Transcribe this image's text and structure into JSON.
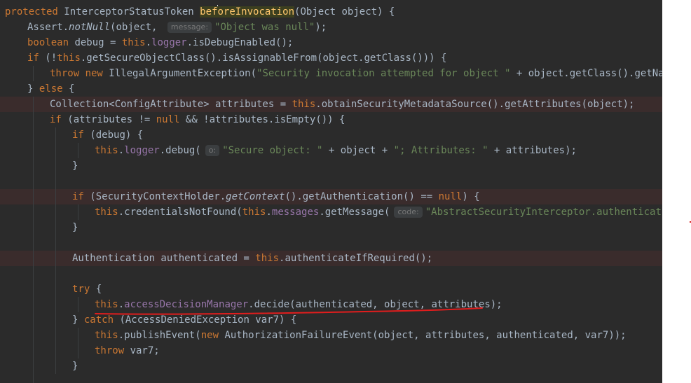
{
  "editor": {
    "line_height": 22,
    "char_width": 8.0,
    "indent_unit": 4,
    "lines": [
      {
        "indent": 0,
        "highlight": false,
        "tokens": [
          {
            "t": "protected ",
            "c": "kw"
          },
          {
            "t": "InterceptorStatusToken ",
            "c": ""
          },
          {
            "t": "bef",
            "c": "fn hl-word"
          },
          {
            "t": "caret",
            "c": "caret"
          },
          {
            "t": "oreInvocation",
            "c": "fn hl-word"
          },
          {
            "t": "(Object object) {",
            "c": ""
          }
        ]
      },
      {
        "indent": 1,
        "highlight": false,
        "tokens": [
          {
            "t": "Assert.",
            "c": ""
          },
          {
            "t": "notNull",
            "c": "it"
          },
          {
            "t": "(object, ",
            "c": ""
          },
          {
            "t": "message:",
            "c": "hint"
          },
          {
            "t": "\"Object was null\"",
            "c": "str"
          },
          {
            "t": ");",
            "c": ""
          }
        ]
      },
      {
        "indent": 1,
        "highlight": false,
        "tokens": [
          {
            "t": "boolean ",
            "c": "kw"
          },
          {
            "t": "debug = ",
            "c": ""
          },
          {
            "t": "this",
            "c": "kw"
          },
          {
            "t": ".",
            "c": ""
          },
          {
            "t": "logger",
            "c": "fld"
          },
          {
            "t": ".isDebugEnabled();",
            "c": ""
          }
        ]
      },
      {
        "indent": 1,
        "highlight": false,
        "tokens": [
          {
            "t": "if ",
            "c": "kw"
          },
          {
            "t": "(!",
            "c": ""
          },
          {
            "t": "this",
            "c": "kw"
          },
          {
            "t": ".getSecureObjectClass().isAssignableFrom(object.getClass())) {",
            "c": ""
          }
        ]
      },
      {
        "indent": 2,
        "highlight": false,
        "tokens": [
          {
            "t": "throw new ",
            "c": "kw"
          },
          {
            "t": "IllegalArgumentException(",
            "c": ""
          },
          {
            "t": "\"Security invocation attempted for object \"",
            "c": "str"
          },
          {
            "t": " + object.getClass().getName() + ",
            "c": ""
          }
        ]
      },
      {
        "indent": 1,
        "highlight": false,
        "tokens": [
          {
            "t": "} ",
            "c": ""
          },
          {
            "t": "else ",
            "c": "kw"
          },
          {
            "t": "{",
            "c": ""
          }
        ]
      },
      {
        "indent": 2,
        "highlight": true,
        "tokens": [
          {
            "t": "Collection<ConfigAttribute> attributes = ",
            "c": ""
          },
          {
            "t": "this",
            "c": "kw"
          },
          {
            "t": ".obtainSecurityMetadataSource().getAttributes(object);",
            "c": ""
          }
        ]
      },
      {
        "indent": 2,
        "highlight": false,
        "tokens": [
          {
            "t": "if ",
            "c": "kw"
          },
          {
            "t": "(attributes != ",
            "c": ""
          },
          {
            "t": "null ",
            "c": "kw"
          },
          {
            "t": "&& !attributes.isEmpty()) {",
            "c": ""
          }
        ]
      },
      {
        "indent": 3,
        "highlight": false,
        "tokens": [
          {
            "t": "if ",
            "c": "kw"
          },
          {
            "t": "(debug) {",
            "c": ""
          }
        ]
      },
      {
        "indent": 4,
        "highlight": false,
        "tokens": [
          {
            "t": "this",
            "c": "kw"
          },
          {
            "t": ".",
            "c": ""
          },
          {
            "t": "logger",
            "c": "fld"
          },
          {
            "t": ".debug(",
            "c": ""
          },
          {
            "t": "o:",
            "c": "hint"
          },
          {
            "t": "\"Secure object: \"",
            "c": "str"
          },
          {
            "t": " + object + ",
            "c": ""
          },
          {
            "t": "\"; Attributes: \"",
            "c": "str"
          },
          {
            "t": " + attributes);",
            "c": ""
          }
        ]
      },
      {
        "indent": 3,
        "highlight": false,
        "tokens": [
          {
            "t": "}",
            "c": ""
          }
        ]
      },
      {
        "indent": 3,
        "highlight": false,
        "tokens": []
      },
      {
        "indent": 3,
        "highlight": true,
        "tokens": [
          {
            "t": "if ",
            "c": "kw"
          },
          {
            "t": "(SecurityContextHolder.",
            "c": ""
          },
          {
            "t": "getContext",
            "c": "it"
          },
          {
            "t": "().getAuthentication() == ",
            "c": ""
          },
          {
            "t": "null",
            "c": "kw"
          },
          {
            "t": ") {",
            "c": ""
          }
        ]
      },
      {
        "indent": 4,
        "highlight": false,
        "tokens": [
          {
            "t": "this",
            "c": "kw"
          },
          {
            "t": ".credentialsNotFound(",
            "c": ""
          },
          {
            "t": "this",
            "c": "kw"
          },
          {
            "t": ".",
            "c": ""
          },
          {
            "t": "messages",
            "c": "fld"
          },
          {
            "t": ".getMessage(",
            "c": ""
          },
          {
            "t": "code:",
            "c": "hint"
          },
          {
            "t": "\"AbstractSecurityInterceptor.authenticationNotFound\"",
            "c": "str"
          }
        ]
      },
      {
        "indent": 3,
        "highlight": false,
        "tokens": [
          {
            "t": "}",
            "c": ""
          }
        ]
      },
      {
        "indent": 3,
        "highlight": false,
        "tokens": []
      },
      {
        "indent": 3,
        "highlight": true,
        "tokens": [
          {
            "t": "Authentication authenticated = ",
            "c": ""
          },
          {
            "t": "this",
            "c": "kw"
          },
          {
            "t": ".authenticateIfRequired();",
            "c": ""
          }
        ]
      },
      {
        "indent": 3,
        "highlight": false,
        "tokens": []
      },
      {
        "indent": 3,
        "highlight": false,
        "tokens": [
          {
            "t": "try ",
            "c": "kw"
          },
          {
            "t": "{",
            "c": ""
          }
        ]
      },
      {
        "indent": 4,
        "highlight": false,
        "tokens": [
          {
            "t": "this",
            "c": "kw"
          },
          {
            "t": ".",
            "c": ""
          },
          {
            "t": "accessDecisionManager",
            "c": "fld"
          },
          {
            "t": ".decide(authenticated, object, attributes);",
            "c": ""
          }
        ]
      },
      {
        "indent": 3,
        "highlight": false,
        "tokens": [
          {
            "t": "} ",
            "c": ""
          },
          {
            "t": "catch ",
            "c": "kw"
          },
          {
            "t": "(AccessDeniedException var7) {",
            "c": ""
          }
        ]
      },
      {
        "indent": 4,
        "highlight": false,
        "tokens": [
          {
            "t": "this",
            "c": "kw"
          },
          {
            "t": ".publishEvent(",
            "c": ""
          },
          {
            "t": "new ",
            "c": "kw"
          },
          {
            "t": "AuthorizationFailureEvent(object, attributes, authenticated, var7));",
            "c": ""
          }
        ]
      },
      {
        "indent": 4,
        "highlight": false,
        "tokens": [
          {
            "t": "throw ",
            "c": "kw"
          },
          {
            "t": "var7;",
            "c": ""
          }
        ]
      },
      {
        "indent": 3,
        "highlight": false,
        "tokens": [
          {
            "t": "}",
            "c": ""
          }
        ]
      },
      {
        "indent": 2,
        "highlight": false,
        "tokens": []
      }
    ]
  },
  "colors": {
    "background": "#2b2b2b",
    "keyword": "#cc7832",
    "string": "#6a8759",
    "field": "#9876aa",
    "text": "#a9b7c6",
    "annotation_underline": "#e11d1d"
  }
}
